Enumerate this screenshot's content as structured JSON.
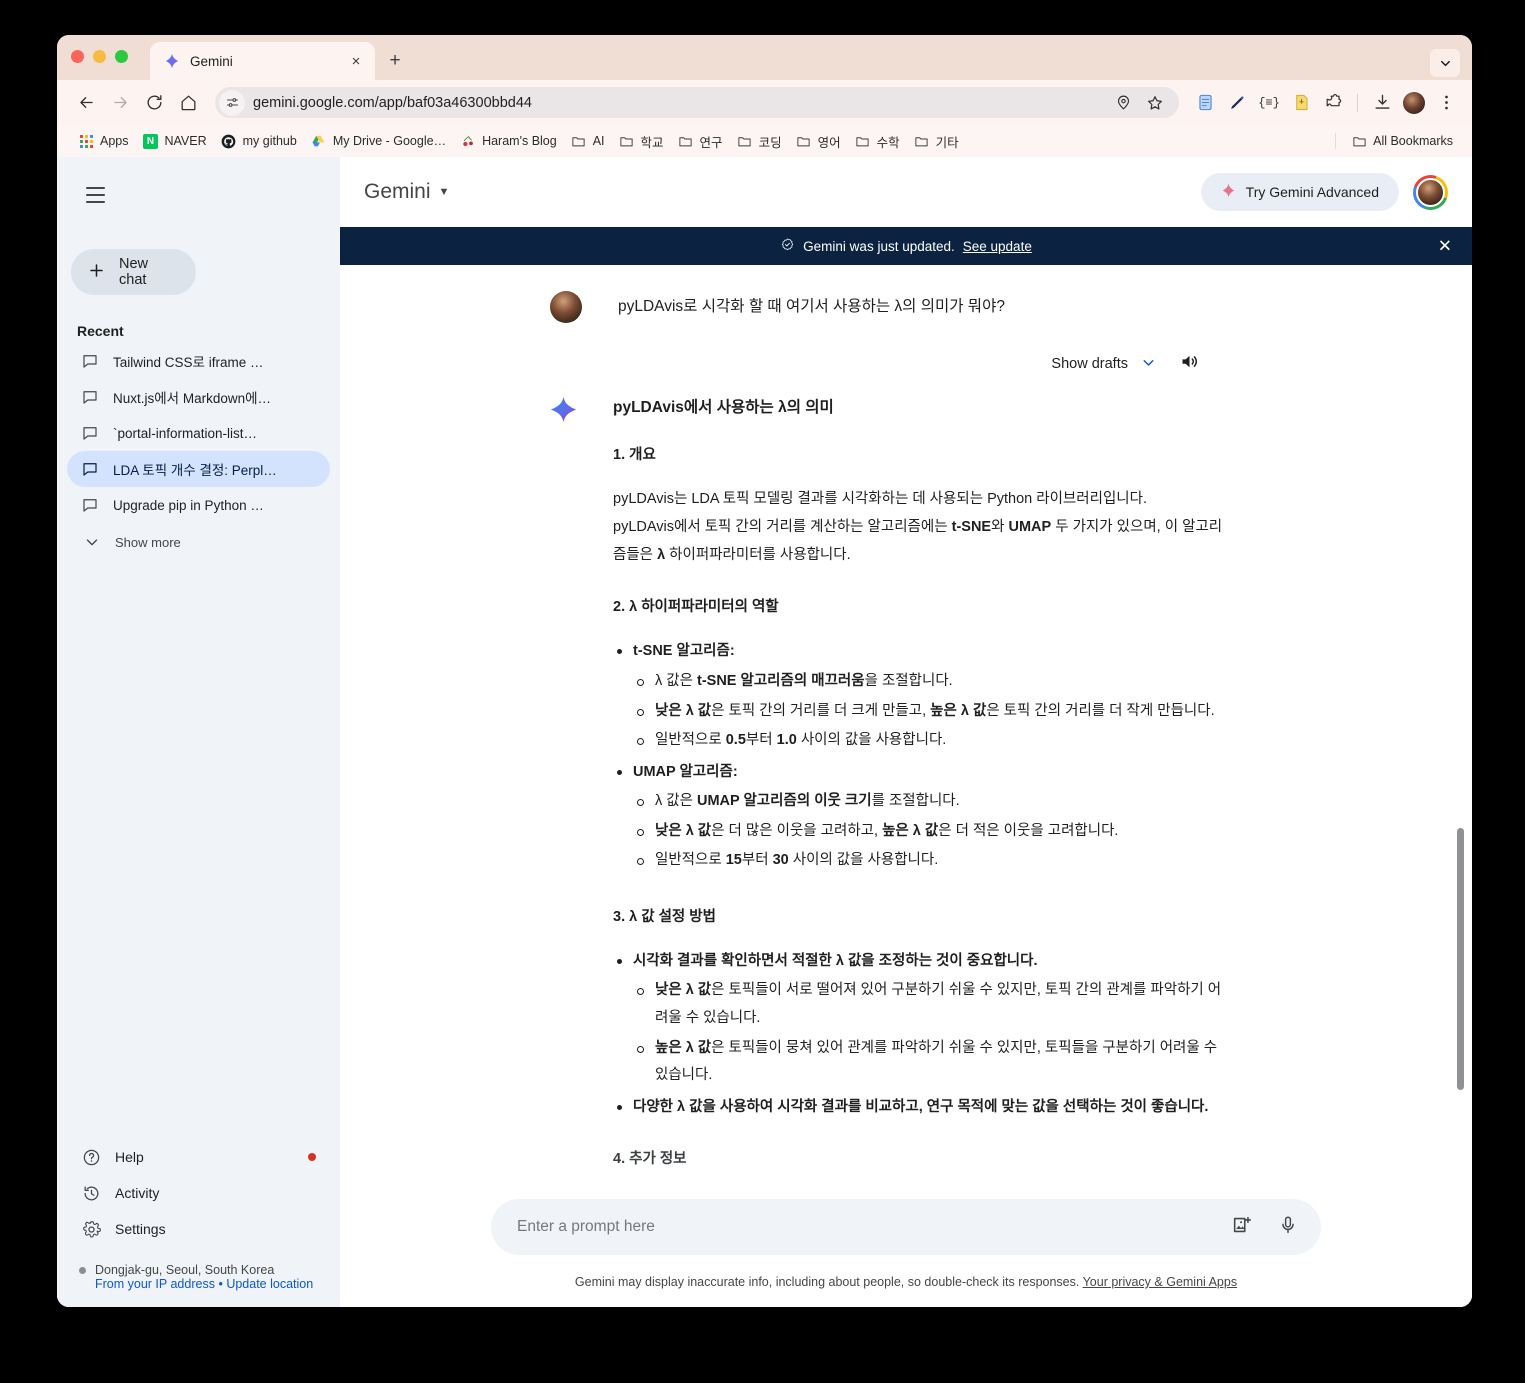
{
  "browser": {
    "tab": {
      "title": "Gemini",
      "favicon": "gemini-sparkle-icon",
      "close": "×"
    },
    "new_tab": "+",
    "url": "gemini.google.com/app/baf03a46300bbd44",
    "nav": {
      "back": "←",
      "forward": "→",
      "reload": "⟳",
      "home": "⌂"
    },
    "bookmarks": [
      {
        "label": "Apps",
        "icon": "apps-grid-icon"
      },
      {
        "label": "NAVER",
        "icon": "naver-icon"
      },
      {
        "label": "my github",
        "icon": "github-icon"
      },
      {
        "label": "My Drive - Google…",
        "icon": "google-drive-icon"
      },
      {
        "label": "Haram's Blog",
        "icon": "cherry-icon"
      },
      {
        "label": "AI",
        "icon": "folder-icon"
      },
      {
        "label": "학교",
        "icon": "folder-icon"
      },
      {
        "label": "연구",
        "icon": "folder-icon"
      },
      {
        "label": "코딩",
        "icon": "folder-icon"
      },
      {
        "label": "영어",
        "icon": "folder-icon"
      },
      {
        "label": "수학",
        "icon": "folder-icon"
      },
      {
        "label": "기타",
        "icon": "folder-icon"
      }
    ],
    "all_bookmarks": "All Bookmarks"
  },
  "sidebar": {
    "new_chat": "New chat",
    "recent_label": "Recent",
    "chats": [
      {
        "label": "Tailwind CSS로 iframe …"
      },
      {
        "label": "Nuxt.js에서 Markdown에…"
      },
      {
        "label": "`portal-information-list…"
      },
      {
        "label": "LDA 토픽 개수 결정: Perpl…"
      },
      {
        "label": "Upgrade pip in Python …"
      }
    ],
    "show_more": "Show more",
    "bottom_items": [
      {
        "label": "Help",
        "icon": "help-icon"
      },
      {
        "label": "Activity",
        "icon": "history-icon"
      },
      {
        "label": "Settings",
        "icon": "gear-icon"
      }
    ],
    "location": "Dongjak-gu, Seoul, South Korea",
    "location_source": "From your IP address",
    "location_sep": "•",
    "location_update": "Update location"
  },
  "header": {
    "title": "Gemini",
    "advanced_button": "Try Gemini Advanced"
  },
  "banner": {
    "text": "Gemini was just updated.",
    "link": "See update",
    "close": "✕"
  },
  "conversation": {
    "user_prompt": "pyLDAvis로 시각화 할 때 여기서 사용하는 λ의 의미가 뭐야?",
    "show_drafts": "Show drafts",
    "response_title": "pyLDAvis에서 사용하는 λ의 의미",
    "sections": {
      "s1_heading": "1. 개요",
      "s1_p1": "pyLDAvis는 LDA 토픽 모델링 결과를 시각화하는 데 사용되는 Python 라이브러리입니다.",
      "s1_p2_a": "pyLDAvis에서 토픽 간의 거리를 계산하는 알고리즘에는 ",
      "s1_p2_b": "t-SNE",
      "s1_p2_c": "와 ",
      "s1_p2_d": "UMAP",
      "s1_p2_e": " 두 가지가 있으며, 이 알고리즘들은 ",
      "s1_p2_f": "λ",
      "s1_p2_g": " 하이퍼파라미터를 사용합니다.",
      "s2_heading": "2. λ 하이퍼파라미터의 역할",
      "tsne_title": "t-SNE 알고리즘:",
      "tsne_1_a": "λ 값은 ",
      "tsne_1_b": "t-SNE 알고리즘의 매끄러움",
      "tsne_1_c": "을 조절합니다.",
      "tsne_2_a": "낮은 λ 값",
      "tsne_2_b": "은 토픽 간의 거리를 더 크게 만들고, ",
      "tsne_2_c": "높은 λ 값",
      "tsne_2_d": "은 토픽 간의 거리를 더 작게 만듭니다.",
      "tsne_3_a": "일반적으로 ",
      "tsne_3_b": "0.5",
      "tsne_3_c": "부터 ",
      "tsne_3_d": "1.0",
      "tsne_3_e": " 사이의 값을 사용합니다.",
      "umap_title": "UMAP 알고리즘:",
      "umap_1_a": "λ 값은 ",
      "umap_1_b": "UMAP 알고리즘의 이웃 크기",
      "umap_1_c": "를 조절합니다.",
      "umap_2_a": "낮은 λ 값",
      "umap_2_b": "은 더 많은 이웃을 고려하고, ",
      "umap_2_c": "높은 λ 값",
      "umap_2_d": "은 더 적은 이웃을 고려합니다.",
      "umap_3_a": "일반적으로 ",
      "umap_3_b": "15",
      "umap_3_c": "부터 ",
      "umap_3_d": "30",
      "umap_3_e": " 사이의 값을 사용합니다.",
      "s3_heading": "3. λ 값 설정 방법",
      "s3_b1": "시각화 결과를 확인하면서 적절한 λ 값을 조정하는 것이 중요합니다.",
      "s3_b1_s1_a": "낮은 λ 값",
      "s3_b1_s1_b": "은 토픽들이 서로 떨어져 있어 구분하기 쉬울 수 있지만, 토픽 간의 관계를 파악하기 어려울 수 있습니다.",
      "s3_b1_s2_a": "높은 λ 값",
      "s3_b1_s2_b": "은 토픽들이 뭉쳐 있어 관계를 파악하기 쉬울 수 있지만, 토픽들을 구분하기 어려울 수 있습니다.",
      "s3_b2": "다양한 λ 값을 사용하여 시각화 결과를 비교하고, 연구 목적에 맞는 값을 선택하는 것이 좋습니다.",
      "s4_heading": "4. 추가 정보"
    }
  },
  "composer": {
    "placeholder": "Enter a prompt here",
    "value": "",
    "image_icon": "add-image-icon",
    "mic_icon": "microphone-icon"
  },
  "footer": {
    "disclaimer": "Gemini may display inaccurate info, including about people, so double-check its responses.",
    "link": "Your privacy & Gemini Apps"
  },
  "colors": {
    "tab_strip": "#f0ddd3",
    "toolbar": "#fdf3f0",
    "bookmarks": "#fdf5f3",
    "sidebar": "#f0f4f9",
    "active_chat": "#d3e3fd",
    "banner": "#0b2341",
    "link": "#0b57d0",
    "advanced_sparkle": "#e8738f"
  }
}
